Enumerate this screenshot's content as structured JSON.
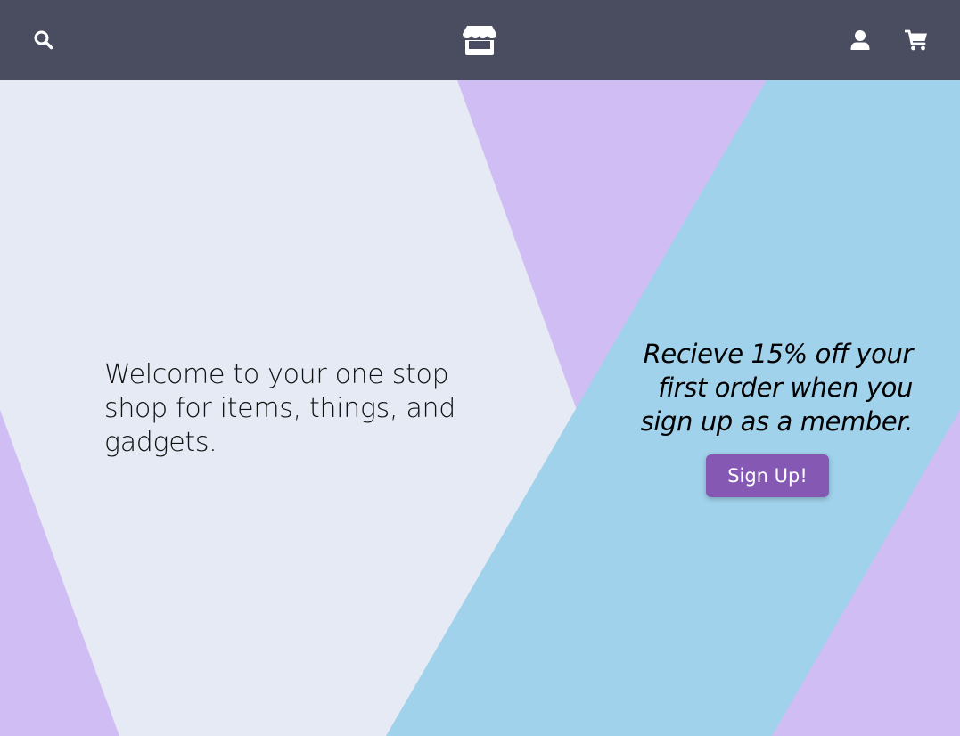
{
  "navbar": {
    "search_icon": "search-icon",
    "logo_icon": "store-icon",
    "account_icon": "user-icon",
    "cart_icon": "cart-icon"
  },
  "hero": {
    "welcome_text": "Welcome to your one stop shop for items, things, and gadgets.",
    "promo_text": "Recieve 15% off your first order when you sign up as a member.",
    "signup_label": "Sign Up!"
  },
  "colors": {
    "navbar": "#494d5f",
    "lavender": "#d0bdf4",
    "light": "#e5eaf5",
    "sky": "#a0d2eb",
    "button": "#8458b3"
  }
}
